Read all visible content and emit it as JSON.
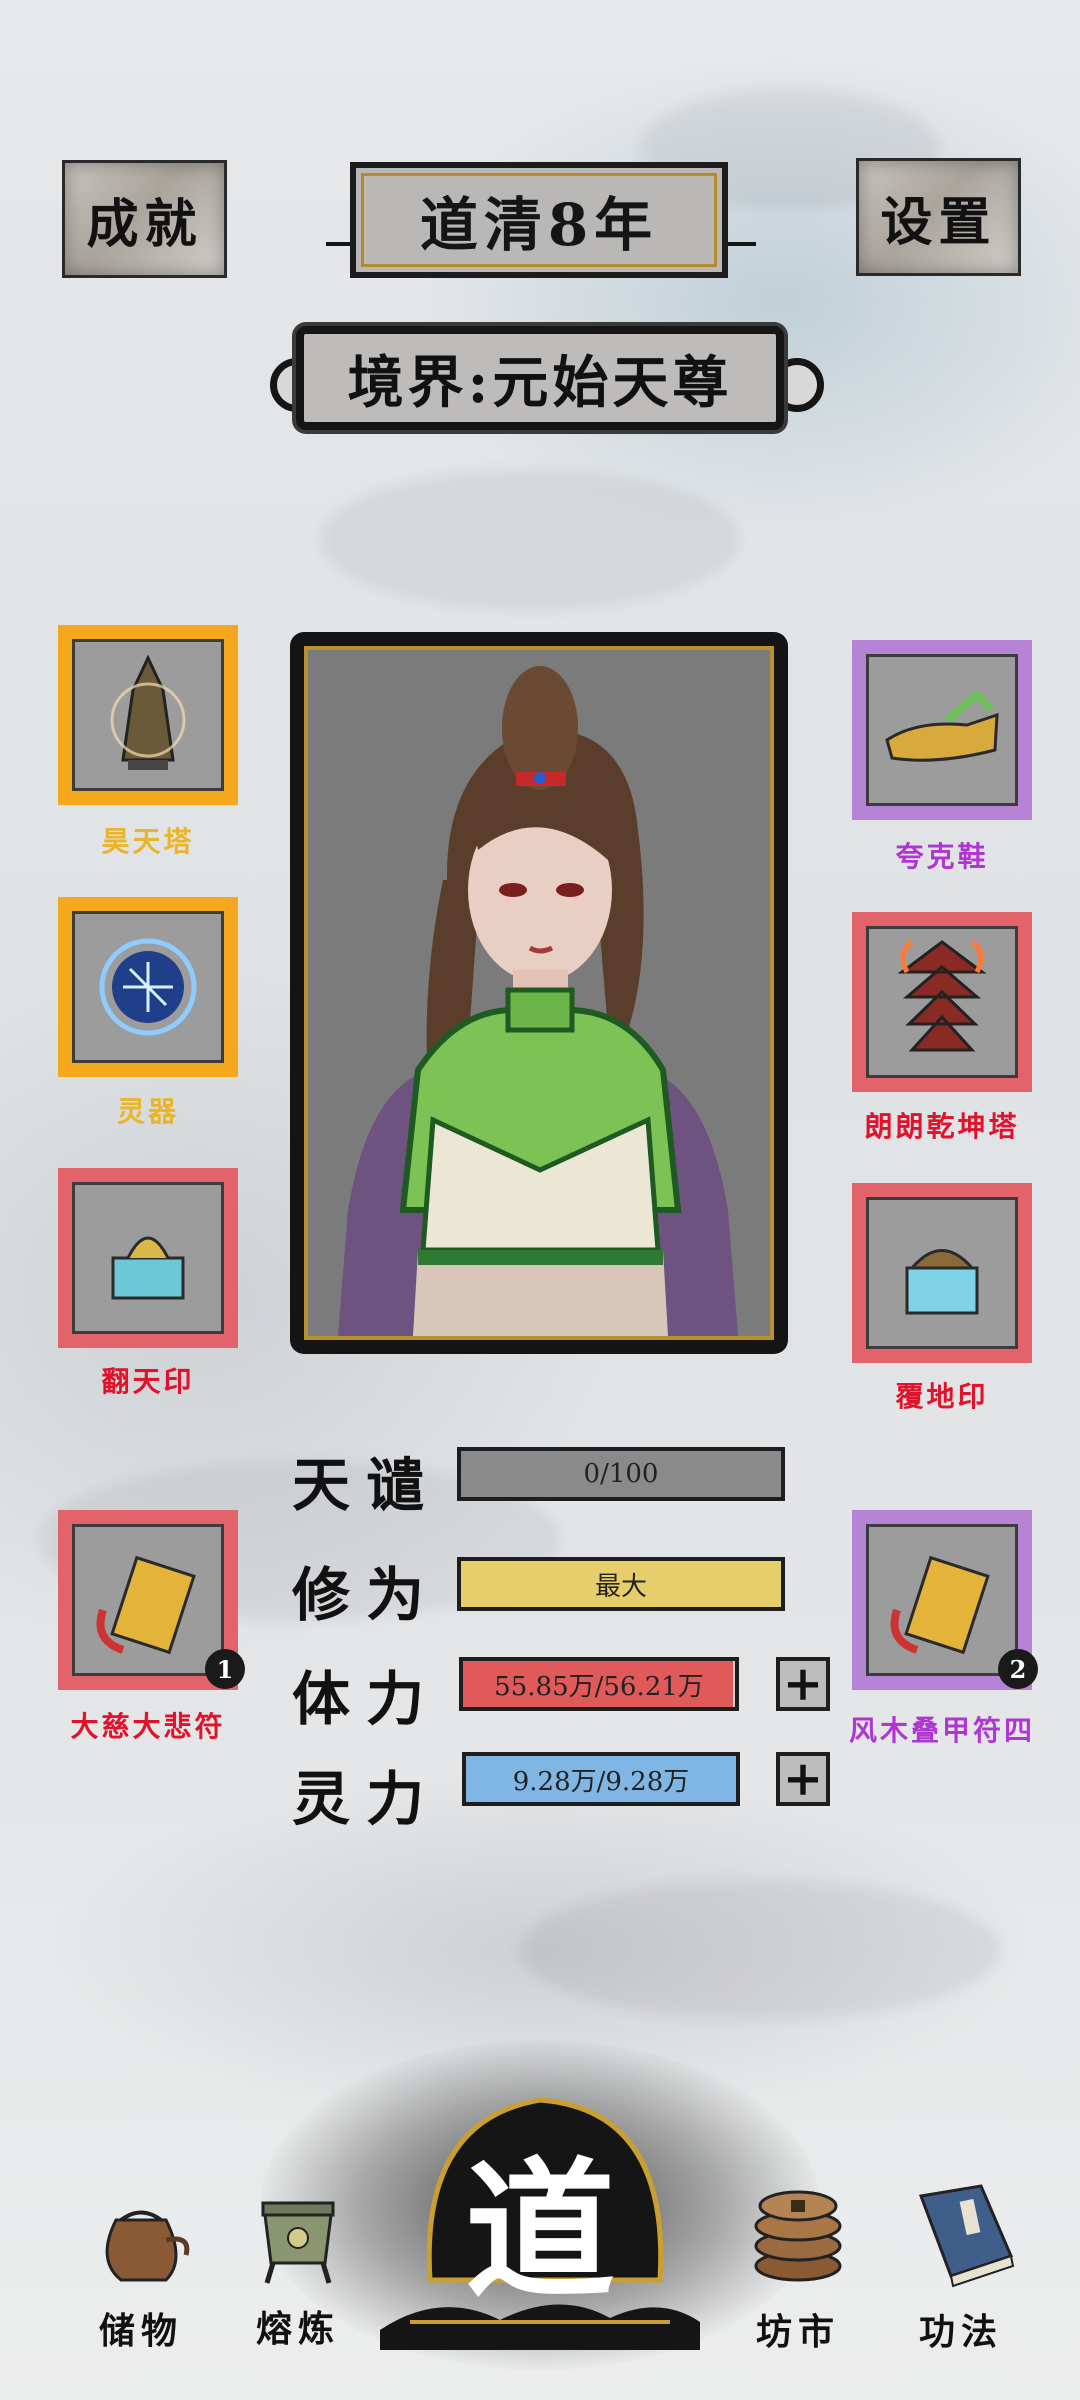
{
  "header": {
    "achievements_label": "成就",
    "year_label": "道清8年",
    "settings_label": "设置",
    "realm_label": "境界:元始天尊"
  },
  "equipment": {
    "left": [
      {
        "name": "昊天塔",
        "rarity": "gold"
      },
      {
        "name": "灵器",
        "rarity": "gold"
      },
      {
        "name": "翻天印",
        "rarity": "red"
      },
      {
        "name": "大慈大悲符",
        "rarity": "red",
        "count": "1"
      }
    ],
    "right": [
      {
        "name": "夸克鞋",
        "rarity": "purple"
      },
      {
        "name": "朗朗乾坤塔",
        "rarity": "red"
      },
      {
        "name": "覆地印",
        "rarity": "red"
      },
      {
        "name": "风木叠甲符四",
        "rarity": "purple",
        "count": "2"
      }
    ]
  },
  "stats": {
    "tianqian": {
      "label": "天谴",
      "value": "0/100",
      "fill": 0.0,
      "color": "#8a8a8a"
    },
    "xiuwei": {
      "label": "修为",
      "value": "最大",
      "fill": 1.0,
      "color": "#e6cf6a"
    },
    "tili": {
      "label": "体力",
      "value": "55.85万/56.21万",
      "fill": 0.994,
      "color": "#e05a5a"
    },
    "lingli": {
      "label": "灵力",
      "value": "9.28万/9.28万",
      "fill": 1.0,
      "color": "#7fb6e3"
    }
  },
  "nav": {
    "storage": "储物",
    "smelting": "熔炼",
    "dao": "道",
    "market": "坊市",
    "skills": "功法"
  },
  "colors": {
    "gold": "#f3a81e",
    "red_rarity": "#e2636a",
    "purple_rarity": "#b783d6",
    "gold_text": "#e9b52a",
    "red_text": "#e3122b",
    "purple_text": "#b036d4"
  }
}
